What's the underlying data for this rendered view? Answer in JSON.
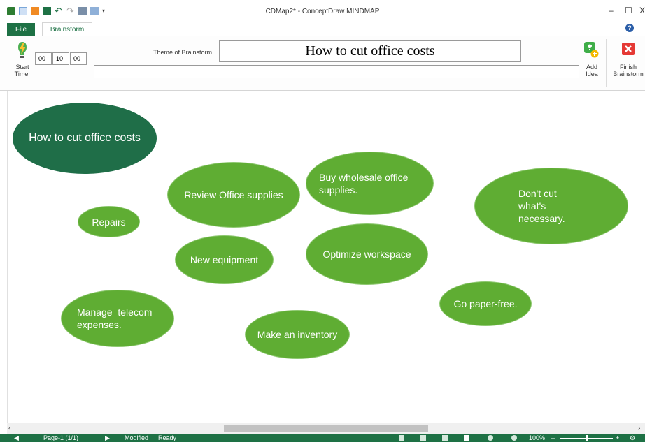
{
  "window": {
    "title": "CDMap2* - ConceptDraw MINDMAP",
    "minimize": "–",
    "maximize": "☐",
    "close": "X"
  },
  "tabs": {
    "file": "File",
    "brainstorm": "Brainstorm"
  },
  "help": "?",
  "ribbon": {
    "start_timer": "Start Timer",
    "timer": {
      "hours": "00",
      "minutes": "10",
      "seconds": "00"
    },
    "theme_label": "Theme of Brainstorm",
    "theme_value": "How to cut office costs",
    "idea_value": "",
    "add_idea": "Add Idea",
    "finish_brainstorm": "Finish Brainstorm"
  },
  "nodes": {
    "root": "How to cut office costs",
    "review": "Review Office supplies",
    "wholesale": "Buy wholesale office supplies.",
    "dont_cut": "Don't cut what's necessary.",
    "repairs": "Repairs",
    "optimize": "Optimize workspace",
    "new_equipment": "New equipment",
    "paper_free": "Go paper-free.",
    "telecom": "Manage  telecom expenses.",
    "inventory": "Make an inventory"
  },
  "status": {
    "page": "Page-1 (1/1)",
    "modified": "Modified",
    "ready": "Ready",
    "zoom": "100%"
  },
  "colors": {
    "accent": "#1e7145",
    "node_fill": "#5fad33",
    "root_fill": "#1f6e48"
  }
}
